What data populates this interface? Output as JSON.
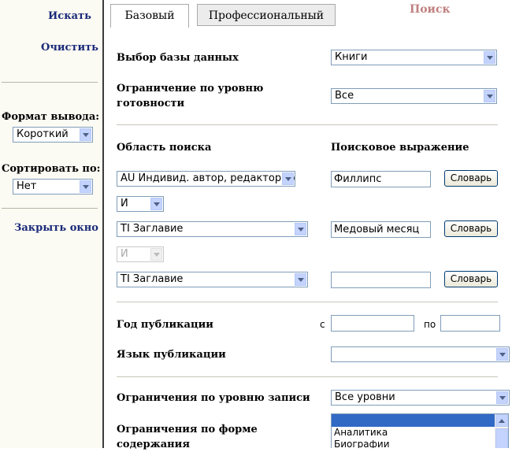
{
  "sidebar": {
    "search_link": "Искать",
    "clear_link": "Очистить",
    "output_format_label": "Формат вывода:",
    "output_format_value": "Короткий",
    "sort_label": "Сортировать по:",
    "sort_value": "Нет",
    "close_link": "Закрыть окно"
  },
  "tabs": [
    {
      "label": "Базовый",
      "active": true
    },
    {
      "label": "Профессиональный",
      "active": false
    }
  ],
  "header_title": "Поиск",
  "database": {
    "label": "Выбор базы данных",
    "value": "Книги"
  },
  "readiness": {
    "label_line1": "Ограничение по уровню",
    "label_line2": "готовности",
    "value": "Все"
  },
  "search": {
    "area_header": "Область поиска",
    "expr_header": "Поисковое выражение",
    "rows": [
      {
        "field": "AU Индивид. автор, редактор, сос",
        "value": "Филлипс",
        "button": "Словарь"
      },
      {
        "field": "TI Заглавие",
        "value": "Медовый месяц",
        "button": "Словарь"
      },
      {
        "field": "TI Заглавие",
        "value": "",
        "button": "Словарь"
      }
    ],
    "operators": [
      "И",
      "И"
    ]
  },
  "year": {
    "label": "Год публикации",
    "from_label": "с",
    "to_label": "по",
    "from_value": "",
    "to_value": ""
  },
  "language": {
    "label": "Язык публикации",
    "value": ""
  },
  "record_level": {
    "label": "Ограничения по уровню записи",
    "value": "Все уровни"
  },
  "content_form": {
    "label_line1": "Ограничения по форме",
    "label_line2": "содержания",
    "options": [
      "",
      "Аналитика",
      "Биографии"
    ]
  }
}
